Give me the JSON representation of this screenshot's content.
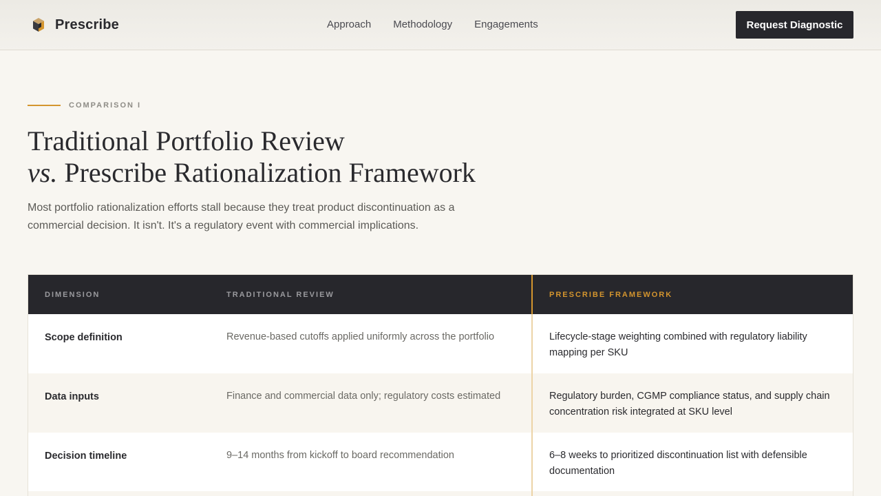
{
  "nav": {
    "brand": "Prescribe",
    "links": [
      "Approach",
      "Methodology",
      "Engagements"
    ],
    "cta": "Request Diagnostic"
  },
  "hero": {
    "eyebrow": "COMPARISON I",
    "title_line1": "Traditional Portfolio Review",
    "title_vs": "vs.",
    "title_line2": " Prescribe Rationalization Framework",
    "lede": "Most portfolio rationalization efforts stall because they treat product discontinuation as a commercial decision. It isn't. It's a regulatory event with commercial implications."
  },
  "table": {
    "headers": [
      "DIMENSION",
      "TRADITIONAL REVIEW",
      "PRESCRIBE FRAMEWORK"
    ],
    "rows": [
      {
        "dimension": "Scope definition",
        "traditional": "Revenue-based cutoffs applied uniformly across the portfolio",
        "prescribe": "Lifecycle-stage weighting combined with regulatory liability mapping per SKU"
      },
      {
        "dimension": "Data inputs",
        "traditional": "Finance and commercial data only; regulatory costs estimated",
        "prescribe": "Regulatory burden, CGMP compliance status, and supply chain concentration risk integrated at SKU level"
      },
      {
        "dimension": "Decision timeline",
        "traditional": "9–14 months from kickoff to board recommendation",
        "prescribe": "6–8 weeks to prioritized discontinuation list with defensible documentation"
      }
    ]
  },
  "colors": {
    "accent": "#d4952e",
    "dark": "#27272c",
    "background": "#f8f6f1"
  },
  "icons": {
    "brand": "hexagon-cube-logo-icon"
  }
}
